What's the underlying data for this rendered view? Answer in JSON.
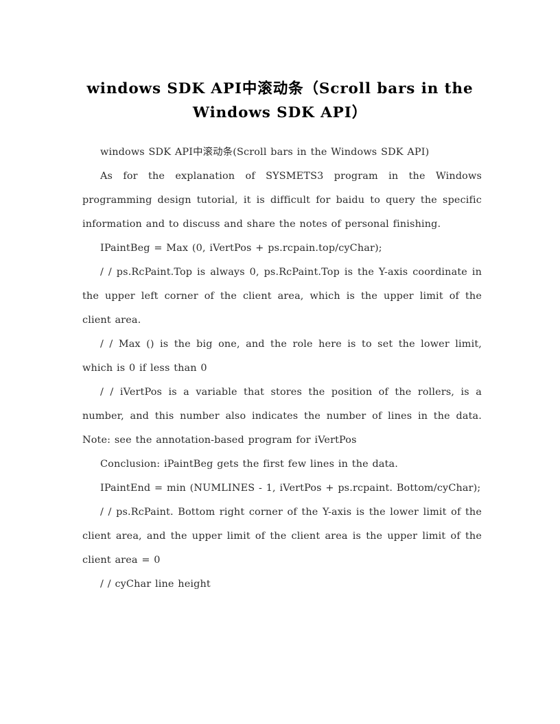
{
  "document": {
    "title": "windows SDK API中滚动条（Scroll bars in the\nWindows SDK API）",
    "paragraphs": [
      {
        "id": "p1",
        "text": "windows SDK API中滚动条(Scroll bars in the Windows SDK API)"
      },
      {
        "id": "p2",
        "text": "As for the explanation of SYSMETS3 program in the Windows programming design tutorial, it is difficult for baidu to query the specific information and to discuss and share the notes of personal finishing."
      },
      {
        "id": "p3",
        "text": "IPaintBeg = Max (0, iVertPos + ps.rcpain.top/cyChar);"
      },
      {
        "id": "p4",
        "text": "/ / ps.RcPaint.Top is always 0, ps.RcPaint.Top is the Y-axis coordinate in the upper left corner of the client area, which is the upper limit of the client area."
      },
      {
        "id": "p5",
        "text": "/ / Max () is the big one, and the role here is to set the lower limit, which is 0 if less than 0"
      },
      {
        "id": "p6",
        "text": "/ / iVertPos is a variable that stores the position of the rollers, is a number, and this number also indicates the number of lines in the data. Note: see the annotation-based program for iVertPos"
      },
      {
        "id": "p7",
        "text": "Conclusion: iPaintBeg gets the first few lines in the data."
      },
      {
        "id": "p8",
        "text": "IPaintEnd = min (NUMLINES - 1, iVertPos + ps.rcpaint. Bottom/cyChar);"
      },
      {
        "id": "p9",
        "text": "/ / ps.RcPaint. Bottom right corner of the Y-axis is the lower limit of the client area, and the upper limit of the client area is the upper limit of the client area = 0"
      },
      {
        "id": "p10",
        "text": "/ / cyChar line height"
      }
    ]
  },
  "colors": {
    "page_background": "#ffffff",
    "title_text": "#000000",
    "body_text": "#2b2b2b"
  }
}
